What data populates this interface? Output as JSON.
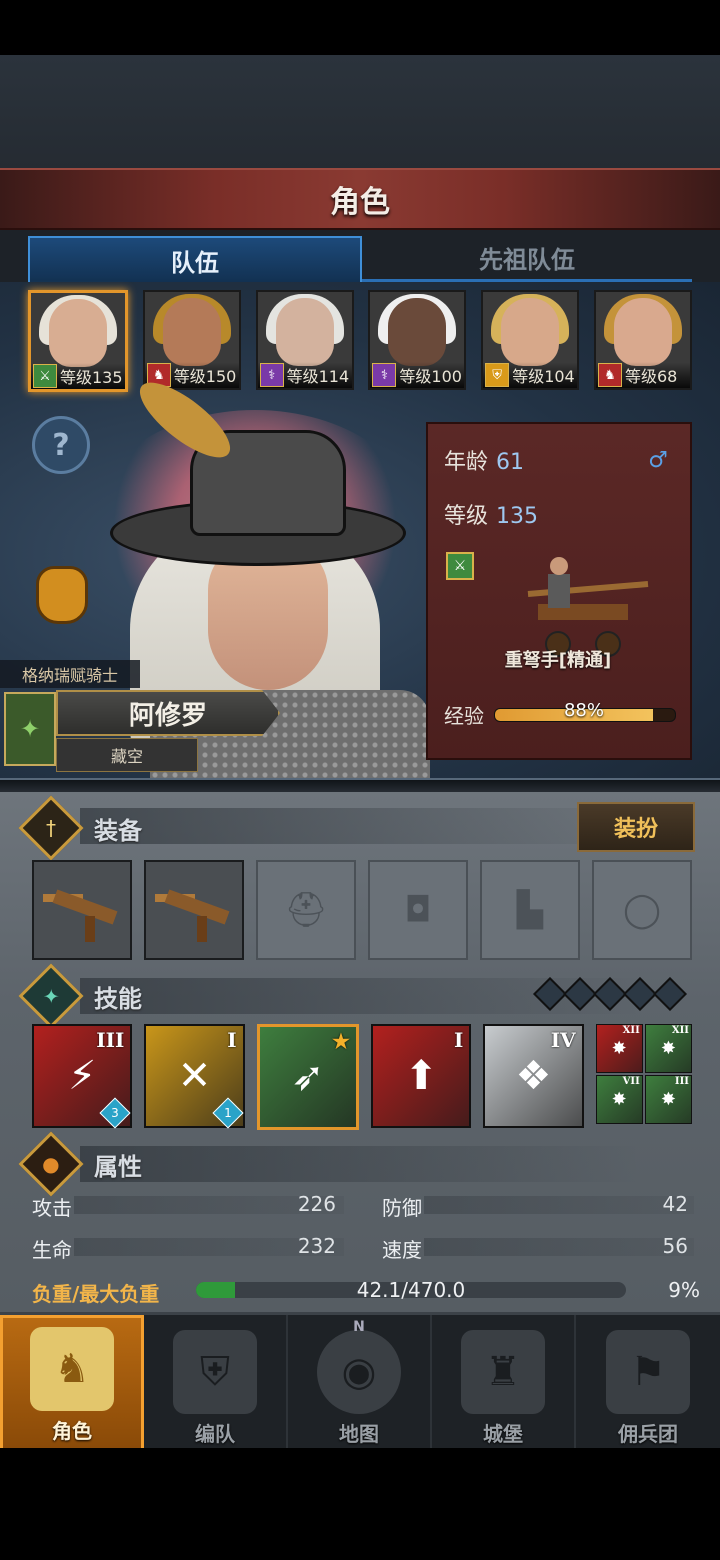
{
  "header": {
    "title": "角色"
  },
  "tabs": [
    {
      "label": "队伍",
      "active": true
    },
    {
      "label": "先祖队伍",
      "active": false
    }
  ],
  "roster": [
    {
      "level_text": "等级135",
      "class_icon": "crossbow-icon",
      "class_color": "#3e8a3e",
      "hair": "#e6e2d8",
      "face": "#d8ad92",
      "selected": true
    },
    {
      "level_text": "等级150",
      "class_icon": "horse-icon",
      "class_color": "#b12a2a",
      "hair": "#b8892a",
      "face": "#b47a58",
      "selected": false
    },
    {
      "level_text": "等级114",
      "class_icon": "staff-icon",
      "class_color": "#7a3aa8",
      "hair": "#e4e4e0",
      "face": "#d3b29e",
      "selected": false
    },
    {
      "level_text": "等级100",
      "class_icon": "staff-icon",
      "class_color": "#7a3aa8",
      "hair": "#efefef",
      "face": "#6a4a3a",
      "selected": false
    },
    {
      "level_text": "等级104",
      "class_icon": "shield-icon",
      "class_color": "#d99a1a",
      "hair": "#d6b25a",
      "face": "#d7a88a",
      "selected": false
    },
    {
      "level_text": "等级68",
      "class_icon": "horse-icon",
      "class_color": "#b12a2a",
      "hair": "#c4933a",
      "face": "#d9a98e",
      "selected": false
    }
  ],
  "character": {
    "title": "格纳瑞赋骑士",
    "name": "阿修罗",
    "trait": "藏空",
    "age_label": "年龄",
    "age": "61",
    "gender_symbol": "♂",
    "level_label": "等级",
    "level": "135",
    "unit_class": "重弩手[精通]",
    "exp_label": "经验",
    "exp_percent": 88,
    "exp_text": "88%"
  },
  "equipment": {
    "label": "装备",
    "dress_button": "装扮",
    "slots": [
      {
        "type": "crossbow",
        "filled": true
      },
      {
        "type": "crossbow",
        "filled": true
      },
      {
        "type": "helmet-icon",
        "filled": false
      },
      {
        "type": "armor-icon",
        "filled": false
      },
      {
        "type": "boots-icon",
        "filled": false
      },
      {
        "type": "ring-icon",
        "filled": false
      }
    ]
  },
  "skills": {
    "label": "技能",
    "list": [
      {
        "rank": "III",
        "color": "#b2201e",
        "stack": "3"
      },
      {
        "rank": "I",
        "color": "#c9961a",
        "stack": "1"
      },
      {
        "rank": "",
        "color": "#3e7e3e",
        "stack": ""
      },
      {
        "rank": "I",
        "color": "#b2201e",
        "stack": ""
      },
      {
        "rank": "IV",
        "color": "#c8cccf",
        "stack": ""
      }
    ],
    "mini": [
      {
        "rank": "XII",
        "color": "#b2201e"
      },
      {
        "rank": "XII",
        "color": "#3e7e3e"
      },
      {
        "rank": "VII",
        "color": "#3e7e3e"
      },
      {
        "rank": "III",
        "color": "#3e7e3e"
      }
    ]
  },
  "attributes": {
    "label": "属性",
    "attack_label": "攻击",
    "attack": "226",
    "defense_label": "防御",
    "defense": "42",
    "hp_label": "生命",
    "hp": "232",
    "speed_label": "速度",
    "speed": "56",
    "load_label": "负重/最大负重",
    "load_text": "42.1/470.0",
    "load_percent_text": "9%",
    "load_percent": 9
  },
  "nav": [
    {
      "label": "角色",
      "active": true
    },
    {
      "label": "编队",
      "active": false
    },
    {
      "label": "地图",
      "active": false,
      "compass": "N"
    },
    {
      "label": "城堡",
      "active": false
    },
    {
      "label": "佣兵团",
      "active": false
    }
  ]
}
